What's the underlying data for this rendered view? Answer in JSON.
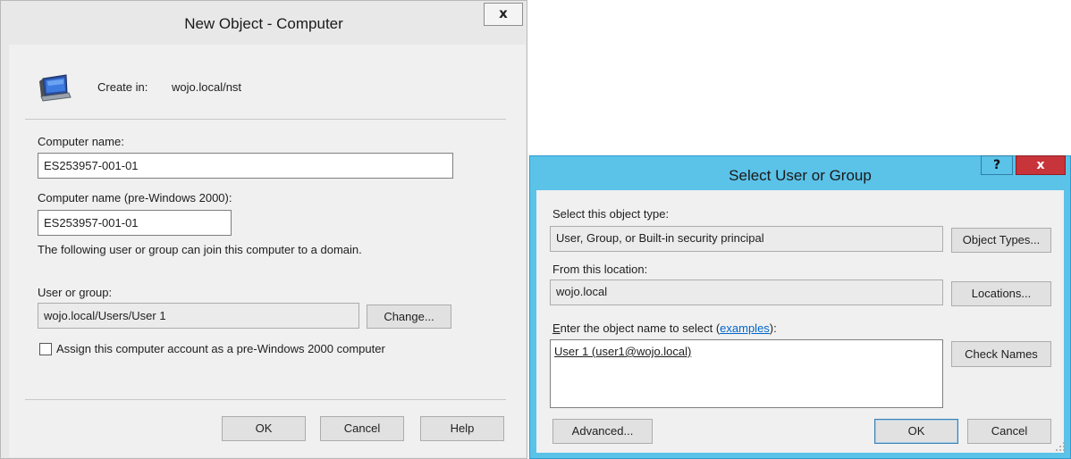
{
  "new_object_dialog": {
    "title": "New Object - Computer",
    "close_glyph": "x",
    "create_in_label": "Create in:",
    "create_in_path": "wojo.local/nst",
    "computer_name_label": "Computer name:",
    "computer_name_value": "ES253957-001-01",
    "pre2000_name_label": "Computer name (pre-Windows 2000):",
    "pre2000_name_value": "ES253957-001-01",
    "join_info": "The following user or group can join this computer to a domain.",
    "user_group_label": "User or group:",
    "user_group_value": "wojo.local/Users/User 1",
    "change_button": "Change...",
    "assign_checkbox_label": "Assign this computer account as a pre-Windows 2000 computer",
    "assign_checked": false,
    "ok_button": "OK",
    "cancel_button": "Cancel",
    "help_button": "Help"
  },
  "select_user_dialog": {
    "title": "Select User or Group",
    "help_glyph": "?",
    "close_glyph": "x",
    "object_type_label": "Select this object type:",
    "object_type_value": "User, Group, or Built-in security principal",
    "object_types_button": "Object Types...",
    "location_label": "From this location:",
    "location_value": "wojo.local",
    "locations_button": "Locations...",
    "enter_name_label_first_char": "E",
    "enter_name_label_rest": "nter the object name to select (",
    "examples_link": "examples",
    "enter_name_label_end": "):",
    "object_name_value": "User 1 (user1@wojo.local)",
    "check_names_button": "Check Names",
    "advanced_button": "Advanced...",
    "ok_button": "OK",
    "cancel_button": "Cancel"
  },
  "colors": {
    "dialog_bg": "#f0f0f0",
    "active_title_bg": "#5bc2e8",
    "close_active_bg": "#c7343a",
    "link": "#0066cc"
  },
  "icons": [
    "computer-icon",
    "close-icon",
    "help-icon"
  ]
}
